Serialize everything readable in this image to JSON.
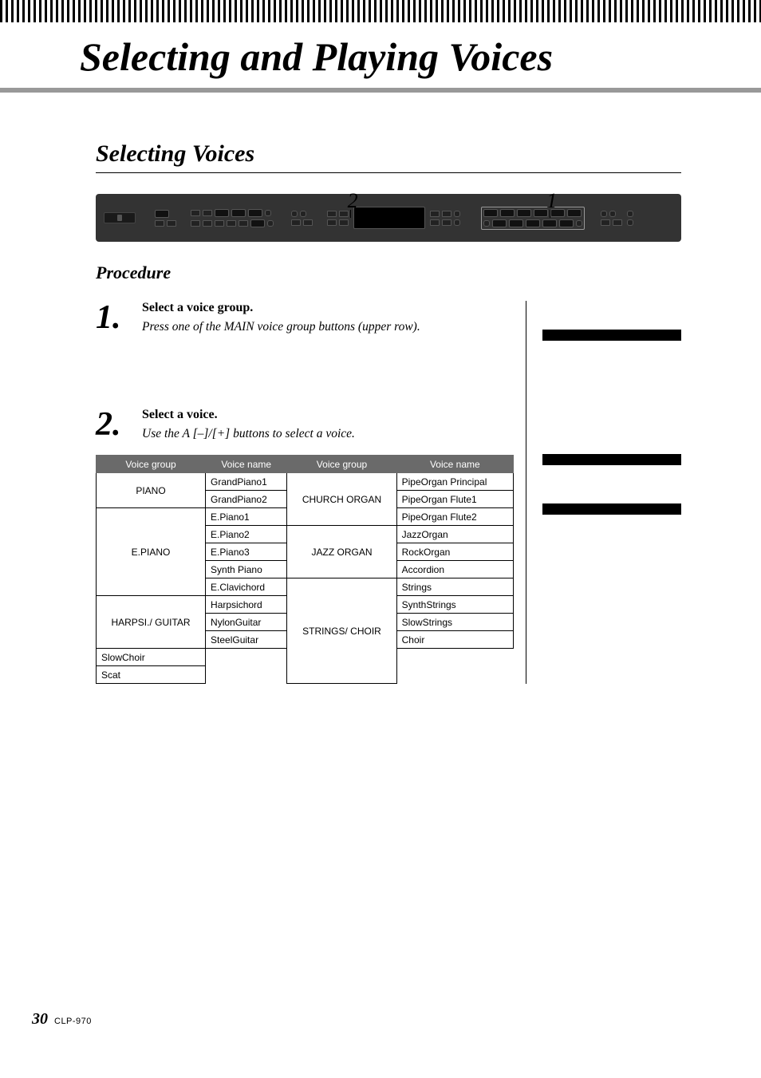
{
  "title": "Selecting and Playing Voices",
  "section_title": "Selecting Voices",
  "callouts": {
    "n1": "1",
    "n2": "2"
  },
  "procedure_label": "Procedure",
  "steps": [
    {
      "num": "1.",
      "bold": "Select a voice group.",
      "ital": "Press one of the MAIN voice group buttons (upper row)."
    },
    {
      "num": "2.",
      "bold": "Select a voice.",
      "ital": "Use the A [–]/[+] buttons to select a voice."
    }
  ],
  "table": {
    "headers": [
      "Voice group",
      "Voice name",
      "Voice group",
      "Voice name"
    ],
    "left": [
      {
        "group": "PIANO",
        "span": 2,
        "voices": [
          "GrandPiano1",
          "GrandPiano2"
        ]
      },
      {
        "group": "E.PIANO",
        "span": 5,
        "voices": [
          "E.Piano1",
          "E.Piano2",
          "E.Piano3",
          "Synth Piano",
          "E.Clavichord"
        ]
      },
      {
        "group": "HARPSI./ GUITAR",
        "span": 3,
        "voices": [
          "Harpsichord",
          "NylonGuitar",
          "SteelGuitar"
        ]
      }
    ],
    "right": [
      {
        "group": "CHURCH ORGAN",
        "span": 3,
        "voices": [
          "PipeOrgan Principal",
          "PipeOrgan Flute1",
          "PipeOrgan Flute2"
        ]
      },
      {
        "group": "JAZZ ORGAN",
        "span": 3,
        "voices": [
          "JazzOrgan",
          "RockOrgan",
          "Accordion"
        ]
      },
      {
        "group": "STRINGS/ CHOIR",
        "span": 6,
        "voices": [
          "Strings",
          "SynthStrings",
          "SlowStrings",
          "Choir",
          "SlowChoir",
          "Scat"
        ]
      }
    ]
  },
  "footer": {
    "page": "30",
    "model": "CLP-970"
  }
}
